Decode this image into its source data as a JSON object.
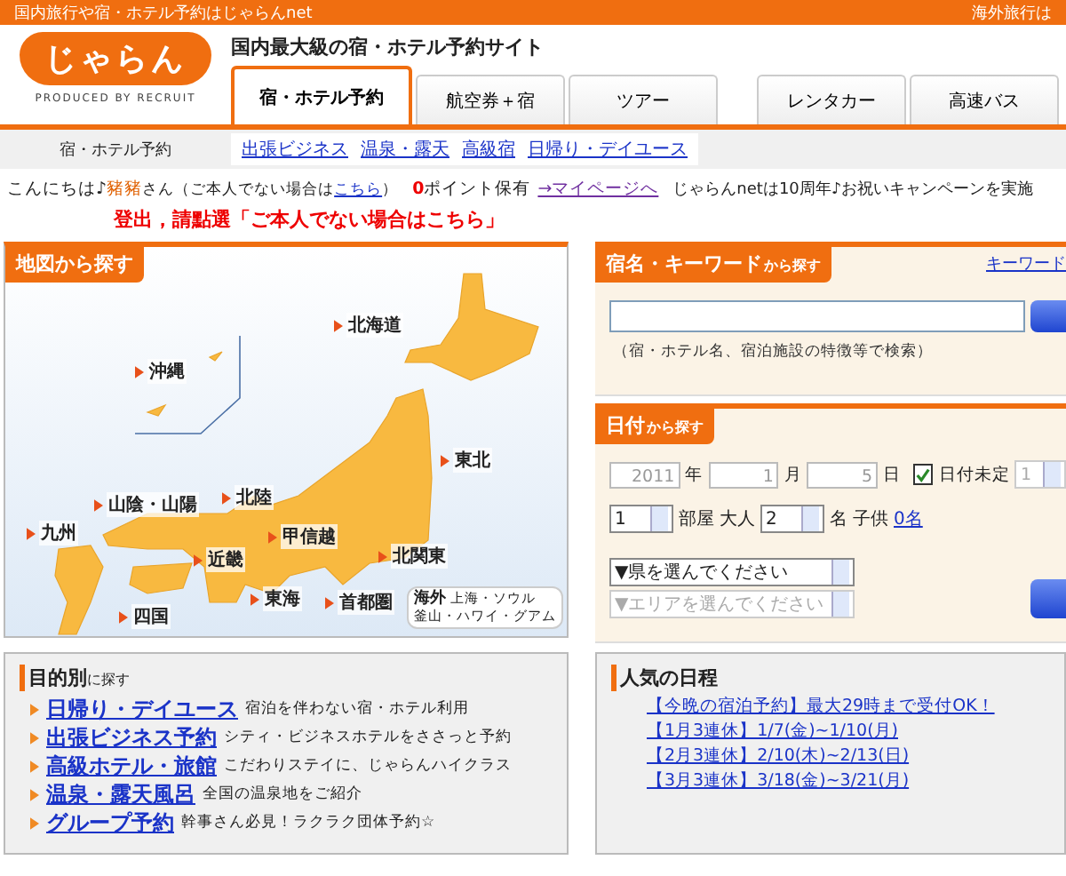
{
  "top_bar": {
    "left": "国内旅行や宿・ホテル予約はじゃらんnet",
    "right": "海外旅行は"
  },
  "logo": {
    "word": "じゃらん",
    "credit": "PRODUCED BY RECRUIT"
  },
  "tagline": "国内最大級の宿・ホテル予約サイト",
  "tabs": [
    {
      "label": "宿・ホテル予約",
      "selected": true
    },
    {
      "label": "航空券＋宿",
      "selected": false
    },
    {
      "label": "ツアー",
      "selected": false
    },
    {
      "label": "レンタカー",
      "selected": false
    },
    {
      "label": "高速バス",
      "selected": false
    }
  ],
  "subnav": {
    "section": "宿・ホテル予約",
    "links": [
      "出張ビジネス",
      "温泉・露天",
      "高級宿",
      "日帰り・デイユース"
    ]
  },
  "greeting": {
    "hello": "こんにちは♪",
    "name": "豬豬",
    "suffix": "さん（ご本人でない場合は",
    "self_link": "こちら",
    "close": "）",
    "points": "0",
    "points_label": "ポイント保有",
    "mypage_link": "→マイページへ",
    "news": "じゃらんnetは10周年♪お祝いキャンペーンを実施"
  },
  "annotation": "登出，請點選「ご本人でない場合はこちら」",
  "map_panel": {
    "heading": "地図から探す",
    "regions": [
      "北海道",
      "沖縄",
      "東北",
      "北陸",
      "山陰・山陽",
      "九州",
      "甲信越",
      "近畿",
      "北関東",
      "東海",
      "首都圏",
      "四国"
    ],
    "overseas": {
      "label": "海外",
      "line1": "上海・ソウル",
      "line2": "釜山・ハワイ・グアム"
    }
  },
  "keyword_panel": {
    "heading": "宿名・キーワード",
    "heading_suffix": "から探す",
    "link": "キーワード",
    "hint": "（宿・ホテル名、宿泊施設の特徴等で検索）"
  },
  "date_panel": {
    "heading": "日付",
    "heading_suffix": "から探す",
    "year": "2011",
    "year_label": "年",
    "month": "1",
    "month_label": "月",
    "day": "5",
    "day_label": "日",
    "undecided": {
      "label": "日付未定",
      "checked": true
    },
    "nights": "1",
    "rooms": "1",
    "rooms_label": "部屋",
    "adults_label": "大人",
    "adults": "2",
    "adults_unit": "名",
    "children_label": "子供",
    "children_link": "0名",
    "prefecture": "▼県を選んでください",
    "area": {
      "value": "▼エリアを選んでください",
      "disabled": true
    }
  },
  "purpose_panel": {
    "heading": "目的別",
    "heading_suffix": "に探す",
    "items": [
      {
        "link": "日帰り・デイユース",
        "desc": "宿泊を伴わない宿・ホテル利用"
      },
      {
        "link": "出張ビジネス予約",
        "desc": "シティ・ビジネスホテルをささっと予約"
      },
      {
        "link": "高級ホテル・旅館",
        "desc": "こだわりステイに、じゃらんハイクラス"
      },
      {
        "link": "温泉・露天風呂",
        "desc": "全国の温泉地をご紹介"
      },
      {
        "link": "グループ予約",
        "desc": "幹事さん必見！ラクラク団体予約☆"
      }
    ]
  },
  "popular_panel": {
    "heading": "人気の日程",
    "links": [
      "【今晩の宿泊予約】最大29時まで受付OK！",
      "【1月3連休】1/7(金)~1/10(月)",
      "【2月3連休】2/10(木)~2/13(日)",
      "【3月3連休】3/18(金)~3/21(月)"
    ]
  }
}
